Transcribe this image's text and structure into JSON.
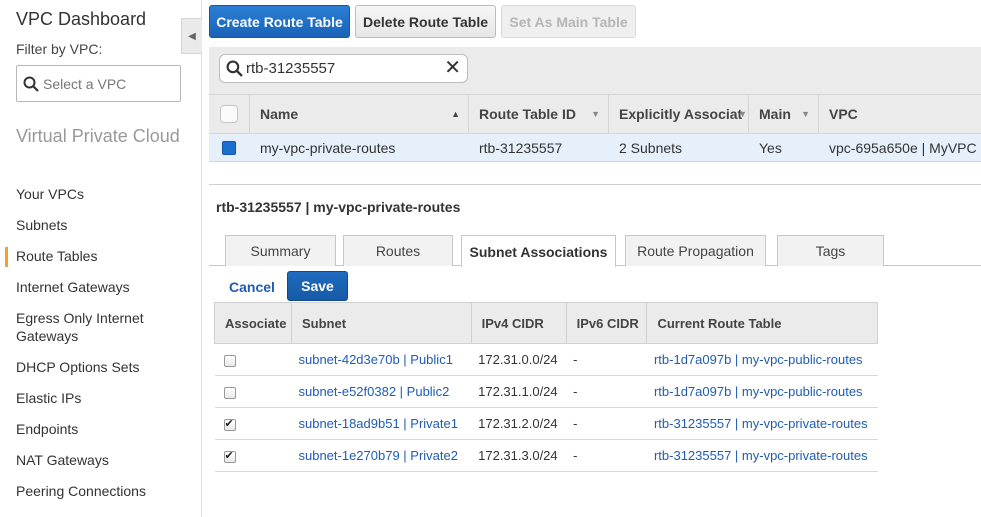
{
  "sidebar": {
    "title": "VPC Dashboard",
    "filter_label": "Filter by VPC:",
    "filter_placeholder": "Select a VPC",
    "section": "Virtual Private Cloud",
    "items": [
      {
        "label": "Your VPCs"
      },
      {
        "label": "Subnets"
      },
      {
        "label": "Route Tables",
        "active": true
      },
      {
        "label": "Internet Gateways"
      },
      {
        "label": "Egress Only Internet Gateways"
      },
      {
        "label": "DHCP Options Sets"
      },
      {
        "label": "Elastic IPs"
      },
      {
        "label": "Endpoints"
      },
      {
        "label": "NAT Gateways"
      },
      {
        "label": "Peering Connections"
      }
    ]
  },
  "toolbar": {
    "create_label": "Create Route Table",
    "delete_label": "Delete Route Table",
    "set_main_label": "Set As Main Table"
  },
  "search": {
    "value": "rtb-31235557"
  },
  "grid": {
    "columns": [
      "Name",
      "Route Table ID",
      "Explicitly Associat",
      "Main",
      "VPC"
    ],
    "row": {
      "name": "my-vpc-private-routes",
      "id": "rtb-31235557",
      "associated": "2 Subnets",
      "main": "Yes",
      "vpc": "vpc-695a650e | MyVPC"
    }
  },
  "detail": {
    "title": "rtb-31235557 | my-vpc-private-routes",
    "tabs": [
      "Summary",
      "Routes",
      "Subnet Associations",
      "Route Propagation",
      "Tags"
    ],
    "active_tab": "Subnet Associations",
    "cancel_label": "Cancel",
    "save_label": "Save"
  },
  "subnet_table": {
    "columns": [
      "Associate",
      "Subnet",
      "IPv4 CIDR",
      "IPv6 CIDR",
      "Current Route Table"
    ],
    "rows": [
      {
        "checked": false,
        "subnet": "subnet-42d3e70b | Public1",
        "ipv4": "172.31.0.0/24",
        "ipv6": "-",
        "route_table": "rtb-1d7a097b | my-vpc-public-routes"
      },
      {
        "checked": false,
        "subnet": "subnet-e52f0382 | Public2",
        "ipv4": "172.31.1.0/24",
        "ipv6": "-",
        "route_table": "rtb-1d7a097b | my-vpc-public-routes"
      },
      {
        "checked": true,
        "subnet": "subnet-18ad9b51 | Private1",
        "ipv4": "172.31.2.0/24",
        "ipv6": "-",
        "route_table": "rtb-31235557 | my-vpc-private-routes"
      },
      {
        "checked": true,
        "subnet": "subnet-1e270b79 | Private2",
        "ipv4": "172.31.3.0/24",
        "ipv6": "-",
        "route_table": "rtb-31235557 | my-vpc-private-routes"
      }
    ]
  },
  "colors": {
    "primary": "#1a63b8",
    "link": "#1e5db3",
    "active_nav": "#f0a030",
    "selected_row": "#e6f0fb"
  }
}
